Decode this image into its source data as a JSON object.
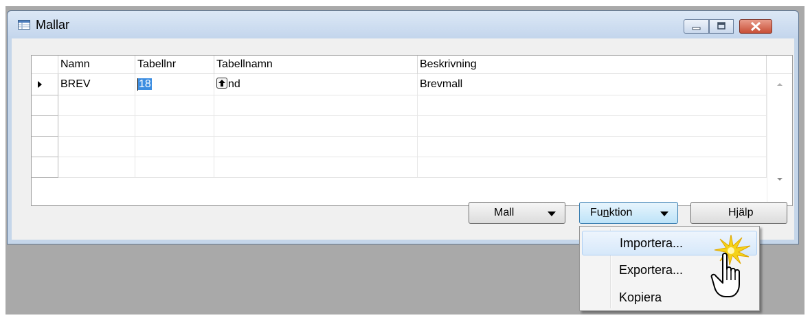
{
  "window": {
    "title": "Mallar",
    "controls": [
      "minimize",
      "maximize",
      "close"
    ]
  },
  "table": {
    "columns": [
      "Namn",
      "Tabellnr",
      "Tabellnamn",
      "Beskrivning"
    ],
    "rows": [
      {
        "namn": "BREV",
        "tabellnr": "18",
        "tabellnamn": "nd",
        "beskrivning": "Brevmall"
      },
      {
        "namn": "",
        "tabellnr": "",
        "tabellnamn": "",
        "beskrivning": ""
      },
      {
        "namn": "",
        "tabellnr": "",
        "tabellnamn": "",
        "beskrivning": ""
      },
      {
        "namn": "",
        "tabellnr": "",
        "tabellnamn": "",
        "beskrivning": ""
      },
      {
        "namn": "",
        "tabellnr": "",
        "tabellnamn": "",
        "beskrivning": ""
      }
    ]
  },
  "buttons": {
    "mall": "Mall",
    "funktion_pre": "Fu",
    "funktion_accel": "n",
    "funktion_post": "ktion",
    "hjalp": "Hjälp"
  },
  "menu": {
    "items": [
      {
        "label": "Importera...",
        "highlighted": true
      },
      {
        "label": "Exportera...",
        "highlighted": false
      },
      {
        "label": "Kopiera",
        "highlighted": false
      }
    ]
  },
  "colors": {
    "selection": "#3c8de1",
    "titlebar": "#c3d5ec",
    "close_button": "#c84f37",
    "highlight_star": "#f5d31a"
  },
  "icons": [
    "table-icon",
    "row-pointer-icon",
    "lookup-arrow-icon",
    "dropdown-arrow-icon",
    "hand-cursor-icon",
    "click-burst-icon"
  ]
}
